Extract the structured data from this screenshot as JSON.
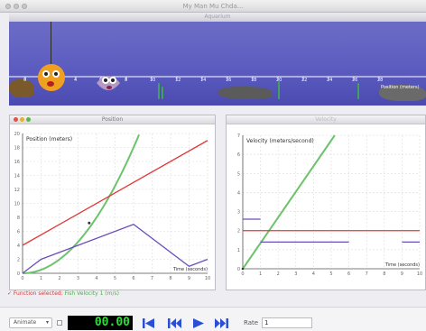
{
  "app": {
    "title": "My Man Mu Chda..."
  },
  "aquarium": {
    "title": "Aquarium",
    "ruler_ticks": [
      "0",
      "2",
      "4",
      "6",
      "8",
      "10",
      "12",
      "14",
      "16",
      "18",
      "20",
      "22",
      "24",
      "26",
      "28"
    ],
    "ruler_caption": "Position (meters)"
  },
  "position_graph": {
    "window_title": "Position",
    "y_title": "Position (meters)",
    "x_title": "Time (seconds)",
    "y_ticks": [
      "0",
      "2",
      "4",
      "6",
      "8",
      "10",
      "12",
      "14",
      "16",
      "18",
      "20"
    ],
    "x_ticks": [
      "0",
      "1",
      "2",
      "3",
      "4",
      "5",
      "6",
      "7",
      "8",
      "9",
      "10"
    ],
    "series_colors": {
      "green": "#6cc36c",
      "red": "#e03a3a",
      "purple": "#6a4fb8"
    }
  },
  "velocity_graph": {
    "window_title": "Velocity",
    "y_title": "Velocity (meters/second)",
    "x_title": "Time (seconds)",
    "y_ticks": [
      "0",
      "1",
      "2",
      "3",
      "4",
      "5",
      "6",
      "7"
    ],
    "x_ticks": [
      "0",
      "1",
      "2",
      "3",
      "4",
      "5",
      "6",
      "7",
      "8",
      "9",
      "10"
    ]
  },
  "status": {
    "text": "✓ Function selected: ",
    "highlight": "Fish Velocity 1 (m/s)"
  },
  "controls": {
    "mode": "Animate",
    "time": "00.00",
    "rate_label": "Rate",
    "rate_value": "1"
  }
}
